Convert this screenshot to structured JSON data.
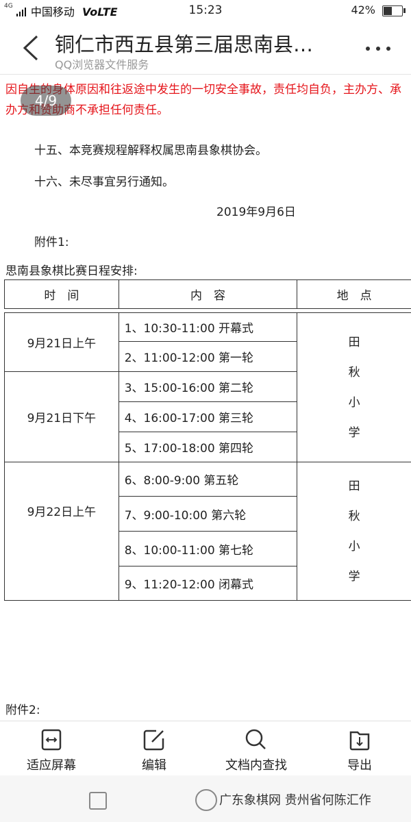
{
  "status_bar": {
    "signal_label": "4G",
    "carrier": "中国移动",
    "network": "VoLTE",
    "time": "15:23",
    "battery_percent": "42%",
    "battery_level": 0.42
  },
  "header": {
    "title": "铜仁市西五县第三届思南县…",
    "subtitle": "QQ浏览器文件服务"
  },
  "page_badge": "4/9",
  "document": {
    "red_text": "因自生的身体原因和往返途中发生的一切安全事故，责任均自负，主办方、承办方和赞助商不承担任何责任。",
    "para_15": "十五、本竞赛规程解释权属思南县象棋协会。",
    "para_16": "十六、未尽事宜另行通知。",
    "date": "2019年9月6日",
    "attachment1": "附件1:",
    "schedule_title": "思南县象棋比赛日程安排:",
    "headers": [
      "时　间",
      "内　容",
      "地　点"
    ],
    "groups": [
      {
        "time": "9月21日上午",
        "items": [
          "1、10:30-11:00  开幕式",
          "2、11:00-12:00  第一轮"
        ]
      },
      {
        "time": "9月21日下午",
        "items": [
          "3、15:00-16:00  第二轮",
          "4、16:00-17:00  第三轮",
          "5、17:00-18:00  第四轮"
        ]
      },
      {
        "time": "9月22日上午",
        "items": [
          "6、8:00-9:00      第五轮",
          "7、9:00-10:00     第六轮",
          "8、10:00-11:00  第七轮",
          "9、11:20-12:00  闭幕式"
        ]
      }
    ],
    "place_day1": [
      "田",
      "秋",
      "小",
      "学"
    ],
    "place_day2": [
      "田",
      "秋",
      "小",
      "学"
    ],
    "attachment2": "附件2:"
  },
  "toolbar": {
    "fit_screen": "适应屏幕",
    "edit": "编辑",
    "find": "文档内查找",
    "export": "导出"
  },
  "watermark": "广东象棋网  贵州省何陈汇作"
}
